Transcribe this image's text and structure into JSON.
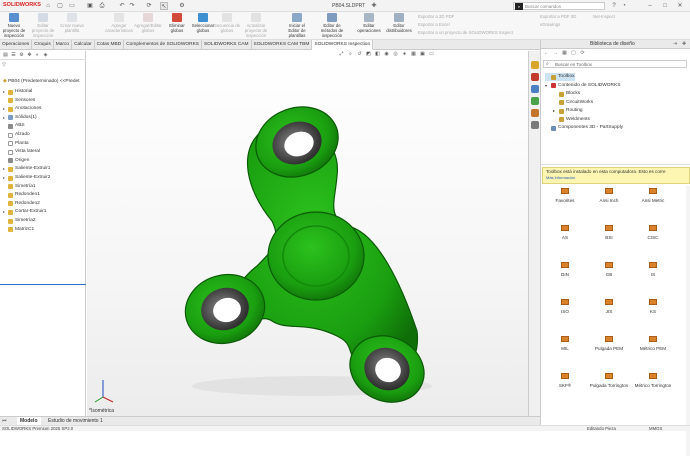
{
  "app": {
    "brand": "SOLIDWORKS",
    "doc_title": "PB04.SLDPRT",
    "search_placeholder": "Buscar comandos"
  },
  "ribbon": {
    "buttons": [
      {
        "label": "Nuevo proyecto de inspección",
        "enabled": true
      },
      {
        "label": "Editar proyecto de inspección",
        "enabled": false
      },
      {
        "label": "Crear nueva plantilla",
        "enabled": false
      },
      {
        "label": "Agregar características",
        "enabled": false
      },
      {
        "label": "Agregar/Editar globos",
        "enabled": false
      },
      {
        "label": "Eliminar globos",
        "enabled": true
      },
      {
        "label": "Seleccionar globos",
        "enabled": true
      },
      {
        "label": "Secuencia de globos",
        "enabled": false
      },
      {
        "label": "Actualizar proyecto de inspección",
        "enabled": false
      },
      {
        "label": "Iniciar el Editor de plantillas",
        "enabled": true
      },
      {
        "label": "Editor de métodos de inspección",
        "enabled": true
      },
      {
        "label": "Editar operaciones",
        "enabled": true
      },
      {
        "label": "Editor distribuidores",
        "enabled": true
      }
    ],
    "right_items": [
      "Exportar a 2D PDF",
      "Exportar a Excel",
      "Exportar a un proyecto de SOLIDWORKS Inspect"
    ],
    "right_items2": [
      "Exportar a PDF 3D",
      "eDrawings"
    ],
    "right_items3": [
      "Net-Inspect"
    ]
  },
  "tabs": [
    "Operaciones",
    "Croquis",
    "Marco",
    "Calcular",
    "Cotas MBD",
    "Complementos de SOLIDWORKS",
    "SOLIDWORKS CAM",
    "SOLIDWORKS CAM TBM",
    "SOLIDWORKS Inspection"
  ],
  "active_tab": "SOLIDWORKS Inspection",
  "tree": {
    "header": "PB04 (Predeterminado) <<Predet",
    "items": [
      {
        "label": "Historial",
        "icon": "history-icon",
        "expand": "▸"
      },
      {
        "label": "Sensores",
        "icon": "sensor-icon",
        "expand": ""
      },
      {
        "label": "Anotaciones",
        "icon": "annotation-icon",
        "expand": "▸"
      },
      {
        "label": "Sólidos(1)",
        "icon": "solid-bodies-icon",
        "expand": "▸"
      },
      {
        "label": "ABS",
        "icon": "material-icon",
        "expand": ""
      },
      {
        "label": "Alzado",
        "icon": "plane-icon",
        "expand": ""
      },
      {
        "label": "Planta",
        "icon": "plane-icon",
        "expand": ""
      },
      {
        "label": "Vista lateral",
        "icon": "plane-icon",
        "expand": ""
      },
      {
        "label": "Origen",
        "icon": "origin-icon",
        "expand": ""
      },
      {
        "label": "Saliente-Extruir1",
        "icon": "extrude-icon",
        "expand": "▸"
      },
      {
        "label": "Saliente-Extruir2",
        "icon": "extrude-icon",
        "expand": "▸"
      },
      {
        "label": "Simetría1",
        "icon": "mirror-icon",
        "expand": ""
      },
      {
        "label": "Redondeo1",
        "icon": "fillet-icon",
        "expand": ""
      },
      {
        "label": "Redondeo2",
        "icon": "fillet-icon",
        "expand": ""
      },
      {
        "label": "Cortar-Extruir1",
        "icon": "cut-extrude-icon",
        "expand": "▸"
      },
      {
        "label": "Simetría2",
        "icon": "mirror-icon",
        "expand": ""
      },
      {
        "label": "MatrizC1",
        "icon": "pattern-icon",
        "expand": ""
      }
    ]
  },
  "viewport": {
    "orientation_label": "*Isométrica",
    "model_color": "#1f9e12",
    "bearing_color": "#6e6e6e"
  },
  "bottom_tabs": [
    "Modelo",
    "Estudio de movimiento 1"
  ],
  "status": {
    "left": "SOLIDWORKS Premium 2025 SP2.0",
    "mid": "Editando Pieza",
    "units": "MMGS"
  },
  "library": {
    "title": "Biblioteca de diseño",
    "search_placeholder": "Buscar en Toolbox",
    "tree": [
      {
        "label": "Toolbox",
        "indent": 0,
        "expand": "",
        "selected": true,
        "icon": "toolbox-icon"
      },
      {
        "label": "Contenido de SOLIDWORKS",
        "indent": 0,
        "expand": "▾",
        "selected": false,
        "icon": "content-icon"
      },
      {
        "label": "Blocks",
        "indent": 1,
        "expand": "",
        "selected": false,
        "icon": "folder-icon"
      },
      {
        "label": "CircuitWorks",
        "indent": 1,
        "expand": "",
        "selected": false,
        "icon": "folder-icon"
      },
      {
        "label": "Routing",
        "indent": 1,
        "expand": "▸",
        "selected": false,
        "icon": "folder-icon"
      },
      {
        "label": "Weldments",
        "indent": 1,
        "expand": "",
        "selected": false,
        "icon": "folder-icon"
      },
      {
        "label": "Componentes 3D - PartSupply",
        "indent": 0,
        "expand": "",
        "selected": false,
        "icon": "partsupply-icon"
      }
    ],
    "notice": "Toolbox está instalado en esta computadora. Esto es corre",
    "notice_more": "Más información",
    "standards": [
      "Favorites",
      "Ansi Inch",
      "Ansi Metric",
      "AS",
      "BSI",
      "CISC",
      "DIN",
      "GB",
      "IS",
      "ISO",
      "JIS",
      "KS",
      "MIL",
      "Pulgada PEM",
      "Métrico PEM",
      "SKF®",
      "Pulgada Torrington",
      "Métrico Torrington"
    ]
  }
}
